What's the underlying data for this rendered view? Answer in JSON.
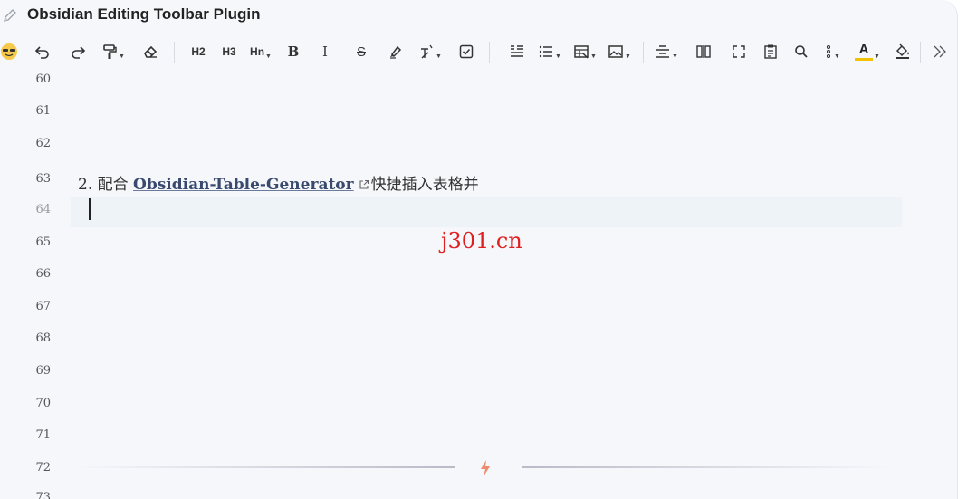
{
  "window": {
    "title": "Obsidian Editing Toolbar Plugin"
  },
  "toolbar": {
    "h2": "H2",
    "h3": "H3",
    "hn": "Hn",
    "bold": "B",
    "italic": "I",
    "strike": "S",
    "text_color": "A"
  },
  "editor": {
    "line_numbers": [
      "60",
      "61",
      "62",
      "63",
      "64",
      "65",
      "66",
      "67",
      "68",
      "69",
      "70",
      "71",
      "72",
      "73"
    ],
    "active_line": "64",
    "line63": {
      "prefix": "2. 配合 ",
      "link_text": "Obsidian-Table-Generator",
      "suffix": "快捷插入表格并"
    },
    "watermark": "j301.cn"
  },
  "colors": {
    "accent_text_color_underline": "#f2c200",
    "link": "#3a4a6e",
    "watermark": "#e02020",
    "hr_icon": "#f08a6a"
  }
}
